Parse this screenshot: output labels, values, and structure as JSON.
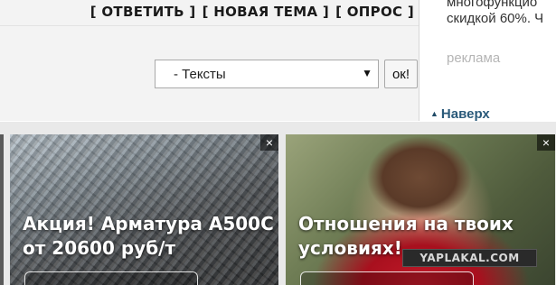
{
  "forum": {
    "actions": {
      "reply": "[ ОТВЕТИТЬ ]",
      "new_topic": "[ НОВАЯ ТЕМА ]",
      "poll": "[ ОПРОС ]"
    },
    "section_select": {
      "selected": "- Тексты"
    },
    "ok_label": "ок!"
  },
  "sidebar": {
    "ad_line1": "многофункцио",
    "ad_line2": "скидкой 60%. Ч",
    "reklama": "реклама",
    "to_top": "Наверх"
  },
  "ads": [
    {
      "title_line1": "Акция! Арматура А500С",
      "title_line2": "от 20600 руб/т",
      "close": "×"
    },
    {
      "title_line1": "Отношения на твоих",
      "title_line2": "условиях!",
      "close": "×"
    }
  ],
  "watermark": "YAPLAKAL.COM"
}
